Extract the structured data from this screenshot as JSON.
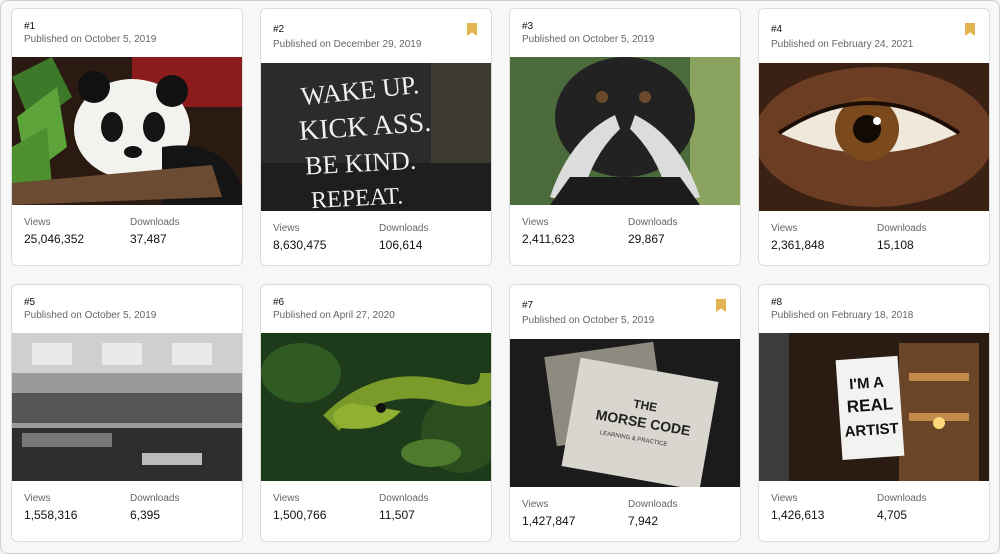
{
  "cards": [
    {
      "rank": "#1",
      "published": "Published on October 5, 2019",
      "views_label": "Views",
      "views": "25,046,352",
      "downloads_label": "Downloads",
      "downloads": "37,487",
      "bookmarked": false,
      "image": "panda"
    },
    {
      "rank": "#2",
      "published": "Published on December 29, 2019",
      "views_label": "Views",
      "views": "8,630,475",
      "downloads_label": "Downloads",
      "downloads": "106,614",
      "bookmarked": true,
      "image": "wake-up-sign",
      "image_text": [
        "WAKE UP.",
        "KICK ASS.",
        "BE KIND.",
        "REPEAT."
      ]
    },
    {
      "rank": "#3",
      "published": "Published on October 5, 2019",
      "views_label": "Views",
      "views": "2,411,623",
      "downloads_label": "Downloads",
      "downloads": "29,867",
      "bookmarked": false,
      "image": "emperor-tamarin"
    },
    {
      "rank": "#4",
      "published": "Published on February 24, 2021",
      "views_label": "Views",
      "views": "2,361,848",
      "downloads_label": "Downloads",
      "downloads": "15,108",
      "bookmarked": true,
      "image": "eye"
    },
    {
      "rank": "#5",
      "published": "Published on October 5, 2019",
      "views_label": "Views",
      "views": "1,558,316",
      "downloads_label": "Downloads",
      "downloads": "6,395",
      "bookmarked": false,
      "image": "office"
    },
    {
      "rank": "#6",
      "published": "Published on April 27, 2020",
      "views_label": "Views",
      "views": "1,500,766",
      "downloads_label": "Downloads",
      "downloads": "11,507",
      "bookmarked": false,
      "image": "snake"
    },
    {
      "rank": "#7",
      "published": "Published on October 5, 2019",
      "views_label": "Views",
      "views": "1,427,847",
      "downloads_label": "Downloads",
      "downloads": "7,942",
      "bookmarked": true,
      "image": "morse-code-book",
      "image_text": [
        "THE",
        "MORSE CODE",
        "LEARNING & PRACTICE"
      ]
    },
    {
      "rank": "#8",
      "published": "Published on February 18, 2018",
      "views_label": "Views",
      "views": "1,426,613",
      "downloads_label": "Downloads",
      "downloads": "4,705",
      "bookmarked": false,
      "image": "real-artist-sign",
      "image_text": [
        "I'M A",
        "REAL",
        "ARTIST"
      ]
    }
  ],
  "colors": {
    "bookmark": "#e2b44f",
    "card_border": "#dcdcdc",
    "muted_text": "#666666"
  }
}
